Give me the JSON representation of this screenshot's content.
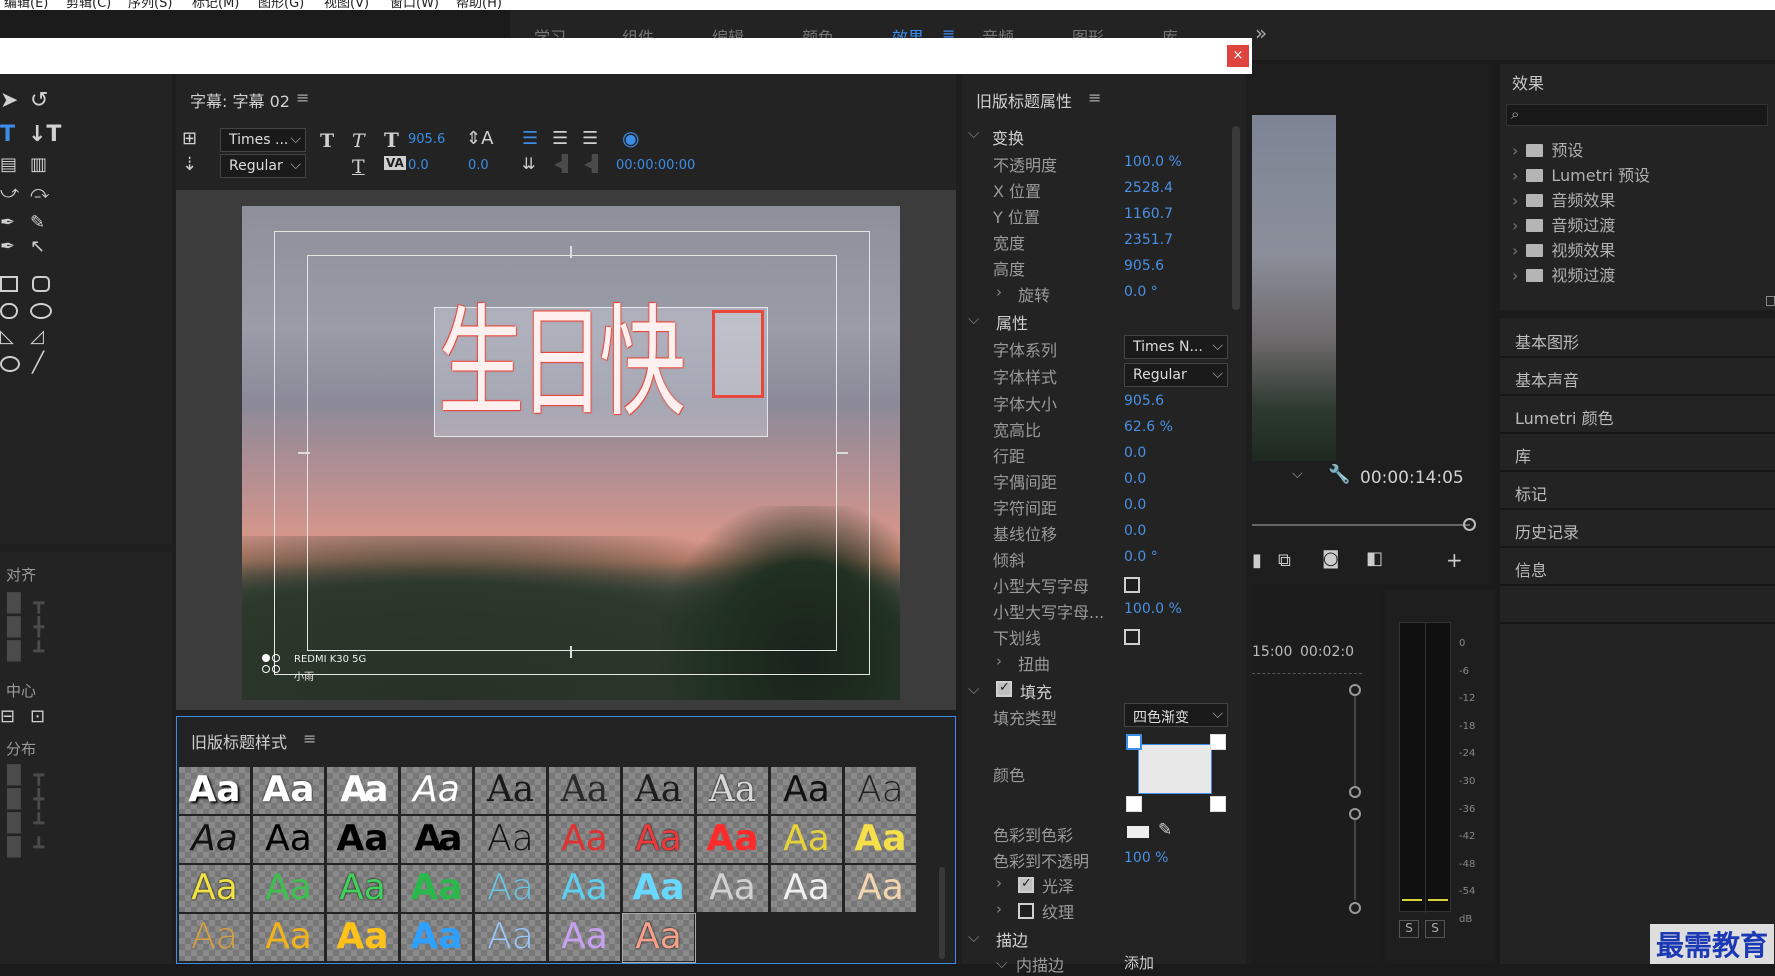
{
  "menubar": [
    "编辑(E)",
    "剪辑(C)",
    "序列(S)",
    "标记(M)",
    "图形(G)",
    "视图(V)",
    "窗口(W)",
    "帮助(H)"
  ],
  "workspaces": [
    {
      "label": "学习",
      "active": false
    },
    {
      "label": "组件",
      "active": false
    },
    {
      "label": "编辑",
      "active": false
    },
    {
      "label": "颜色",
      "active": false
    },
    {
      "label": "效果",
      "active": true
    },
    {
      "label": "音频",
      "active": false
    },
    {
      "label": "图形",
      "active": false
    },
    {
      "label": "库",
      "active": false
    }
  ],
  "workspace_menu_glyph": "≡",
  "workspace_more_glyph": "»",
  "dialog": {
    "close_glyph": "×"
  },
  "title_panel": {
    "title": "字幕: 字幕 02",
    "menu_glyph": "≡",
    "font_family": "Times ...",
    "font_style": "Regular",
    "font_size": "905.6",
    "kerning": "0.0",
    "leading": "0.0",
    "timecode": "00:00:00:00",
    "canvas_text": "生日快",
    "watermark_line1": "REDMI K30 5G",
    "watermark_line2": "小雨"
  },
  "tools_panel": {
    "sections": [
      "对齐",
      "中心",
      "分布"
    ]
  },
  "styles_panel": {
    "title": "旧版标题样式",
    "menu_glyph": "≡",
    "sample": "Aa",
    "swatches": [
      {
        "color": "#ffffff",
        "style": "bold-sans-shadow"
      },
      {
        "color": "#ffffff",
        "style": "bold-sans-outline"
      },
      {
        "color": "#ffffff",
        "style": "bold-condensed"
      },
      {
        "color": "#ffffff",
        "style": "italic-thin"
      },
      {
        "color": "#1a1a1a",
        "style": "serif"
      },
      {
        "color": "#2a2a2a",
        "style": "serif-light"
      },
      {
        "color": "#1e1e1e",
        "style": "serif"
      },
      {
        "color": "#d8d8d8",
        "style": "serif-outline"
      },
      {
        "color": "#111111",
        "style": "sans"
      },
      {
        "color": "#222222",
        "style": "sans-light"
      },
      {
        "color": "#111111",
        "style": "italic"
      },
      {
        "color": "#000000",
        "style": "sans"
      },
      {
        "color": "#000000",
        "style": "bold"
      },
      {
        "color": "#000000",
        "style": "bold-condensed"
      },
      {
        "color": "#111111",
        "style": "thin"
      },
      {
        "color": "#e03131",
        "style": "red"
      },
      {
        "color": "#f03a3a",
        "style": "red-outline"
      },
      {
        "color": "#ff2a2a",
        "style": "red-bold"
      },
      {
        "color": "#e8d23a",
        "style": "yellow"
      },
      {
        "color": "#f5e04a",
        "style": "yellow-bold"
      },
      {
        "color": "#f1e142",
        "style": "yellow-outline"
      },
      {
        "color": "#3cc14f",
        "style": "green"
      },
      {
        "color": "#3fd15a",
        "style": "green-outline"
      },
      {
        "color": "#2bb84b",
        "style": "green-bold"
      },
      {
        "color": "#66c8e6",
        "style": "light-blue"
      },
      {
        "color": "#5bd0f0",
        "style": "cyan"
      },
      {
        "color": "#68d8ff",
        "style": "cyan-bold"
      },
      {
        "color": "#d0d0d0",
        "style": "grey"
      },
      {
        "color": "#f0f0f0",
        "style": "silver"
      },
      {
        "color": "#f2d5b0",
        "style": "peach"
      },
      {
        "color": "#d9a13a",
        "style": "gold-light"
      },
      {
        "color": "#f2b21a",
        "style": "gold"
      },
      {
        "color": "#ffc21a",
        "style": "gold-bold"
      },
      {
        "color": "#2ea0ff",
        "style": "blue-bold"
      },
      {
        "color": "#9ac8ff",
        "style": "blue-light"
      },
      {
        "color": "#c8a0f0",
        "style": "purple"
      },
      {
        "color": "#f4a08a",
        "style": "salmon-outline"
      }
    ]
  },
  "props_panel": {
    "title": "旧版标题属性",
    "menu_glyph": "≡",
    "sections": {
      "transform": "变换",
      "attributes": "属性",
      "fill": "填充",
      "stroke": "描边"
    },
    "rows": {
      "opacity": {
        "label": "不透明度",
        "value": "100.0 %"
      },
      "x_pos": {
        "label": "X 位置",
        "value": "2528.4"
      },
      "y_pos": {
        "label": "Y 位置",
        "value": "1160.7"
      },
      "width": {
        "label": "宽度",
        "value": "2351.7"
      },
      "height": {
        "label": "高度",
        "value": "905.6"
      },
      "rotation": {
        "label": "旋转",
        "value": "0.0 °"
      },
      "font_family": {
        "label": "字体系列",
        "value": "Times N..."
      },
      "font_style": {
        "label": "字体样式",
        "value": "Regular"
      },
      "font_size": {
        "label": "字体大小",
        "value": "905.6"
      },
      "aspect": {
        "label": "宽高比",
        "value": "62.6 %"
      },
      "leading": {
        "label": "行距",
        "value": "0.0"
      },
      "kerning": {
        "label": "字偶间距",
        "value": "0.0"
      },
      "tracking": {
        "label": "字符间距",
        "value": "0.0"
      },
      "baseline": {
        "label": "基线位移",
        "value": "0.0"
      },
      "slant": {
        "label": "倾斜",
        "value": "0.0 °"
      },
      "small_caps": {
        "label": "小型大写字母"
      },
      "small_caps_size": {
        "label": "小型大写字母...",
        "value": "100.0 %"
      },
      "underline": {
        "label": "下划线"
      },
      "distort": {
        "label": "扭曲"
      },
      "fill_type": {
        "label": "填充类型",
        "value": "四色渐变"
      },
      "color": {
        "label": "颜色"
      },
      "color_to_color": {
        "label": "色彩到色彩"
      },
      "color_to_opacity": {
        "label": "色彩到不透明",
        "value": "100 %"
      },
      "sheen": {
        "label": "光泽"
      },
      "texture": {
        "label": "纹理"
      },
      "inner_stroke": {
        "label": "内描边",
        "value": "添加"
      }
    }
  },
  "program_monitor": {
    "timecode": "00:00:14:05",
    "ruler_labels": [
      "15:00",
      "00:02:0"
    ]
  },
  "audio_meter": {
    "scale": [
      "0",
      "-6",
      "-12",
      "-18",
      "-24",
      "-30",
      "-36",
      "-42",
      "-48",
      "-54",
      "dB"
    ],
    "solo_labels": [
      "S",
      "S"
    ]
  },
  "effects_panel": {
    "title": "效果",
    "search_glyph": "⌕",
    "items": [
      "预设",
      "Lumetri 预设",
      "音频效果",
      "音频过渡",
      "视频效果",
      "视频过渡"
    ]
  },
  "right_panels": [
    "基本图形",
    "基本声音",
    "Lumetri 颜色",
    "库",
    "标记",
    "历史记录",
    "信息"
  ],
  "watermark": "最需教育",
  "colors": {
    "accent": "#3c8de6",
    "panel_bg": "#232323",
    "close_red": "#e0443e",
    "title_text_red": "#e8473b"
  }
}
